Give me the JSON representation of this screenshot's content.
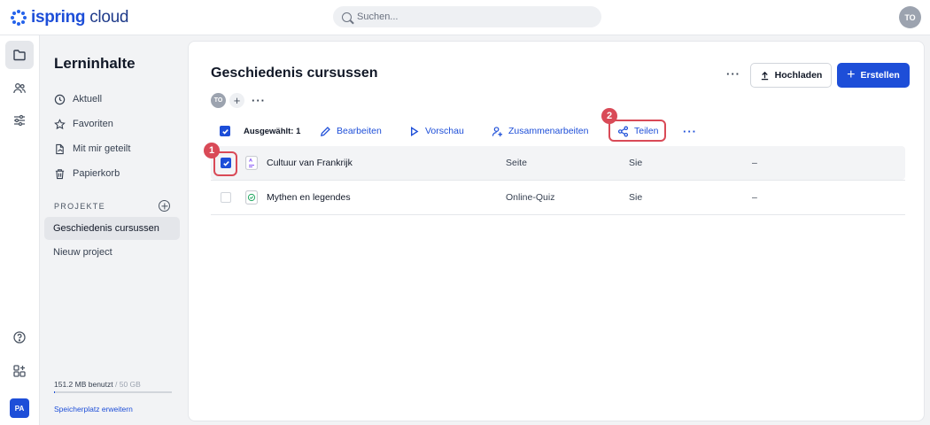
{
  "app": {
    "logo_text_bold": "ispring",
    "logo_text": " cloud",
    "user_initials": "TO"
  },
  "search": {
    "placeholder": "Suchen..."
  },
  "rail": {
    "user_initials": "PA",
    "icons": [
      "folder-icon",
      "users-icon",
      "sliders-icon",
      "help-icon",
      "apps-add-icon"
    ]
  },
  "sidebar": {
    "title": "Lerninhalte",
    "nav": [
      {
        "label": "Aktuell",
        "icon": "clock-icon"
      },
      {
        "label": "Favoriten",
        "icon": "star-icon"
      },
      {
        "label": "Mit mir geteilt",
        "icon": "shared-file-icon"
      },
      {
        "label": "Papierkorb",
        "icon": "trash-icon"
      }
    ],
    "projects_label": "PROJEKTE",
    "projects": [
      {
        "label": "Geschiedenis cursussen",
        "active": true
      },
      {
        "label": "Nieuw project",
        "active": false
      }
    ],
    "storage": {
      "used": "151.2 MB benutzt",
      "limit": " / 50 GB",
      "used_fraction": 0.003,
      "upgrade_link": "Speicherplatz erweitern"
    }
  },
  "main": {
    "title": "Geschiedenis cursussen",
    "member_initials": "TO",
    "upload_label": "Hochladen",
    "create_label": "Erstellen",
    "toolbar": {
      "selected_label": "Ausgewählt: 1",
      "edit_label": "Bearbeiten",
      "preview_label": "Vorschau",
      "collaborate_label": "Zusammenarbeiten",
      "share_label": "Teilen"
    },
    "rows": [
      {
        "name": "Cultuur van Frankrijk",
        "type": "Seite",
        "owner": "Sie",
        "modified": "–",
        "selected": true
      },
      {
        "name": "Mythen en legendes",
        "type": "Online-Quiz",
        "owner": "Sie",
        "modified": "–",
        "selected": false
      }
    ]
  },
  "annotations": {
    "step1": "1",
    "step2": "2"
  },
  "colors": {
    "accent": "#1d4ed8",
    "highlight": "#d94a57"
  }
}
